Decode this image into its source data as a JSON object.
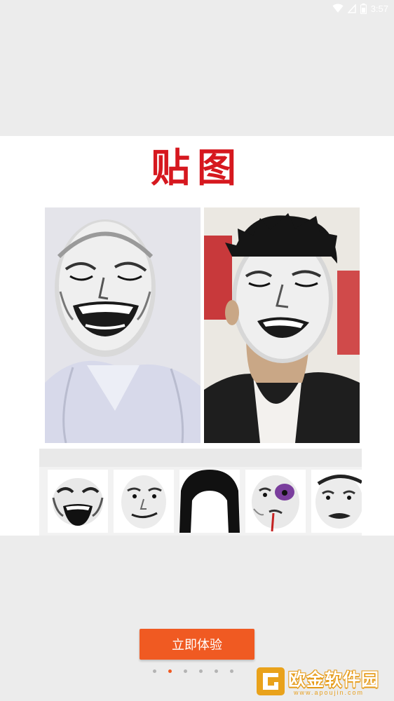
{
  "status_bar": {
    "time": "3:57",
    "icons": [
      "wifi-icon",
      "signal-icon",
      "battery-icon"
    ]
  },
  "banner": {
    "title": "贴图",
    "title_color": "#d6181f"
  },
  "photos": [
    {
      "name": "photo-left",
      "subject": "man-white-shirt-meme-face"
    },
    {
      "name": "photo-right",
      "subject": "man-dark-jacket-meme-face"
    }
  ],
  "stickers": [
    {
      "name": "sticker-laughing-face"
    },
    {
      "name": "sticker-smirk-face"
    },
    {
      "name": "sticker-black-hair"
    },
    {
      "name": "sticker-bruised-face"
    },
    {
      "name": "sticker-grimace-face"
    }
  ],
  "cta": {
    "label": "立即体验",
    "color": "#f05a22"
  },
  "pagination": {
    "total": 6,
    "current": 2
  },
  "watermark": {
    "text": "欧金软件园",
    "url": "www.apoujin.com"
  }
}
